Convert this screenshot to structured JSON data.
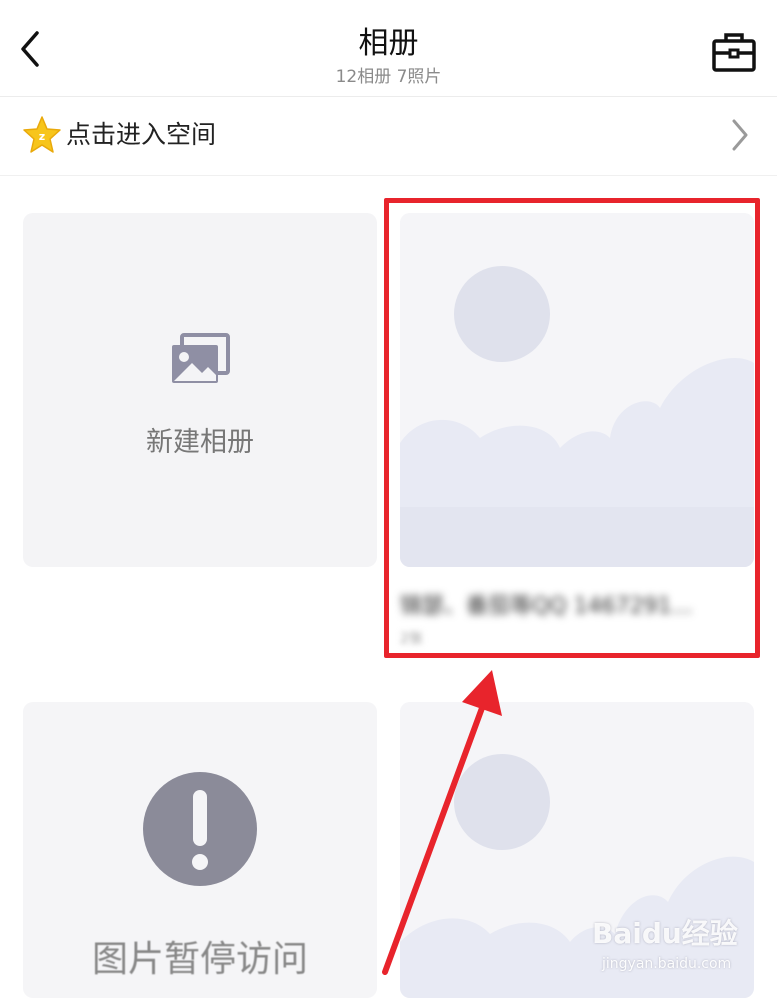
{
  "header": {
    "title": "相册",
    "subtitle": "12相册  7照片",
    "back_icon": "chevron-left-icon",
    "tool_icon": "toolbox-icon"
  },
  "space_entry": {
    "label": "点击进入空间",
    "icon": "star-badge-icon",
    "chevron_icon": "chevron-right-icon"
  },
  "albums": [
    {
      "type": "new",
      "label": "新建相册",
      "icon": "gallery-icon"
    },
    {
      "type": "album",
      "name": "锦瑟、番茄等QQ 1467291...",
      "count": "2张",
      "highlighted": true
    },
    {
      "type": "unavailable",
      "label": "图片暂停访问",
      "icon": "exclamation-icon"
    },
    {
      "type": "album",
      "name": "",
      "count": ""
    }
  ],
  "annotation": {
    "highlight_color": "#e8242c"
  },
  "watermark": {
    "text": "Baidu经验",
    "sub": "jingyan.baidu.com"
  },
  "colors": {
    "placeholder_bg": "#f5f5f7",
    "sun": "#dfe1ec",
    "cloud": "#e7e9f3",
    "star": "#f7c51b"
  }
}
